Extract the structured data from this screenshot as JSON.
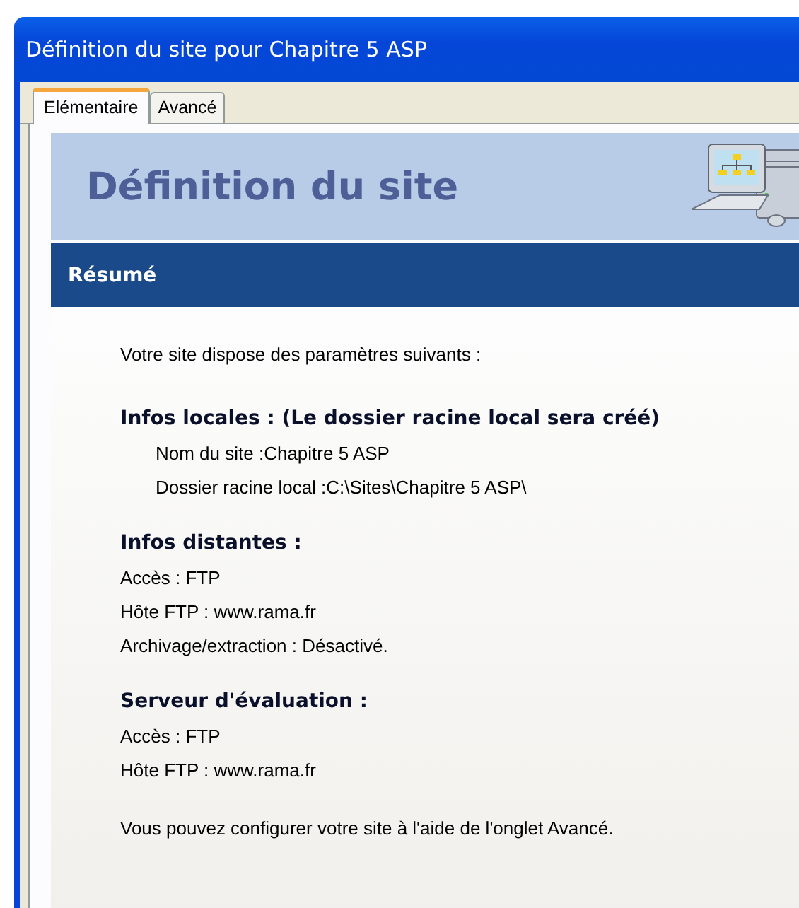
{
  "window": {
    "title": "Définition du site pour Chapitre 5 ASP"
  },
  "tabs": [
    {
      "label": "Elémentaire",
      "selected": true
    },
    {
      "label": "Avancé",
      "selected": false
    }
  ],
  "header": {
    "title": "Définition du site"
  },
  "section_bar": {
    "title": "Résumé"
  },
  "intro": "Votre site dispose des paramètres suivants :",
  "sections": [
    {
      "heading": "Infos locales : (Le dossier racine local sera créé)",
      "lines": [
        {
          "text": "Nom du site :Chapitre 5 ASP",
          "indented": true
        },
        {
          "text": "Dossier racine local :C:\\Sites\\Chapitre 5 ASP\\",
          "indented": true
        }
      ]
    },
    {
      "heading": "Infos distantes :",
      "lines": [
        {
          "text": "Accès : FTP",
          "indented": false
        },
        {
          "text": "Hôte FTP : www.rama.fr",
          "indented": false
        },
        {
          "text": "Archivage/extraction : Désactivé.",
          "indented": false
        }
      ]
    },
    {
      "heading": "Serveur d'évaluation :",
      "lines": [
        {
          "text": "Accès : FTP",
          "indented": false
        },
        {
          "text": "Hôte FTP : www.rama.fr",
          "indented": false
        }
      ]
    }
  ],
  "footer": "Vous pouvez configurer votre site à l'aide de l'onglet Avancé."
}
